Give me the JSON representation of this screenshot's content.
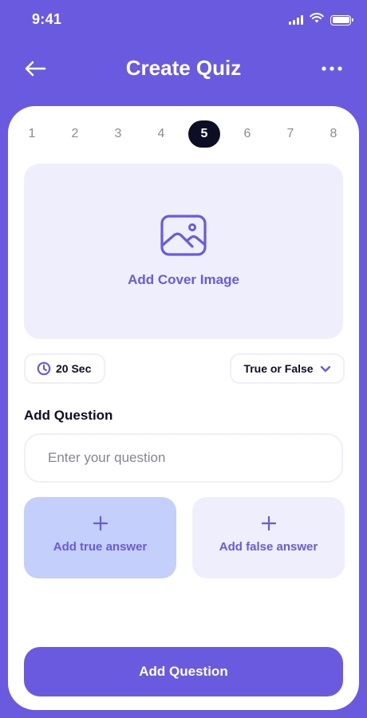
{
  "status_bar": {
    "time": "9:41"
  },
  "header": {
    "title": "Create Quiz",
    "back_icon": "arrow-left-icon",
    "more_icon": "more-horizontal-icon"
  },
  "steps": {
    "items": [
      "1",
      "2",
      "3",
      "4",
      "5",
      "6",
      "7",
      "8"
    ],
    "active": "5"
  },
  "cover": {
    "label": "Add Cover Image",
    "icon": "image-icon"
  },
  "timer": {
    "label": "20 Sec",
    "icon": "clock-icon"
  },
  "question_type": {
    "selected": "True or False",
    "icon": "chevron-down-icon"
  },
  "question": {
    "heading": "Add Question",
    "placeholder": "Enter your question",
    "value": ""
  },
  "answers": {
    "true_label": "Add true answer",
    "false_label": "Add false answer",
    "icon": "plus-icon"
  },
  "submit": {
    "label": "Add Question"
  },
  "colors": {
    "primary": "#6A5AE0",
    "dark": "#0D0D26",
    "light": "#EFEEFC",
    "true_answer_bg": "#C4D0FB",
    "muted": "#858494"
  }
}
